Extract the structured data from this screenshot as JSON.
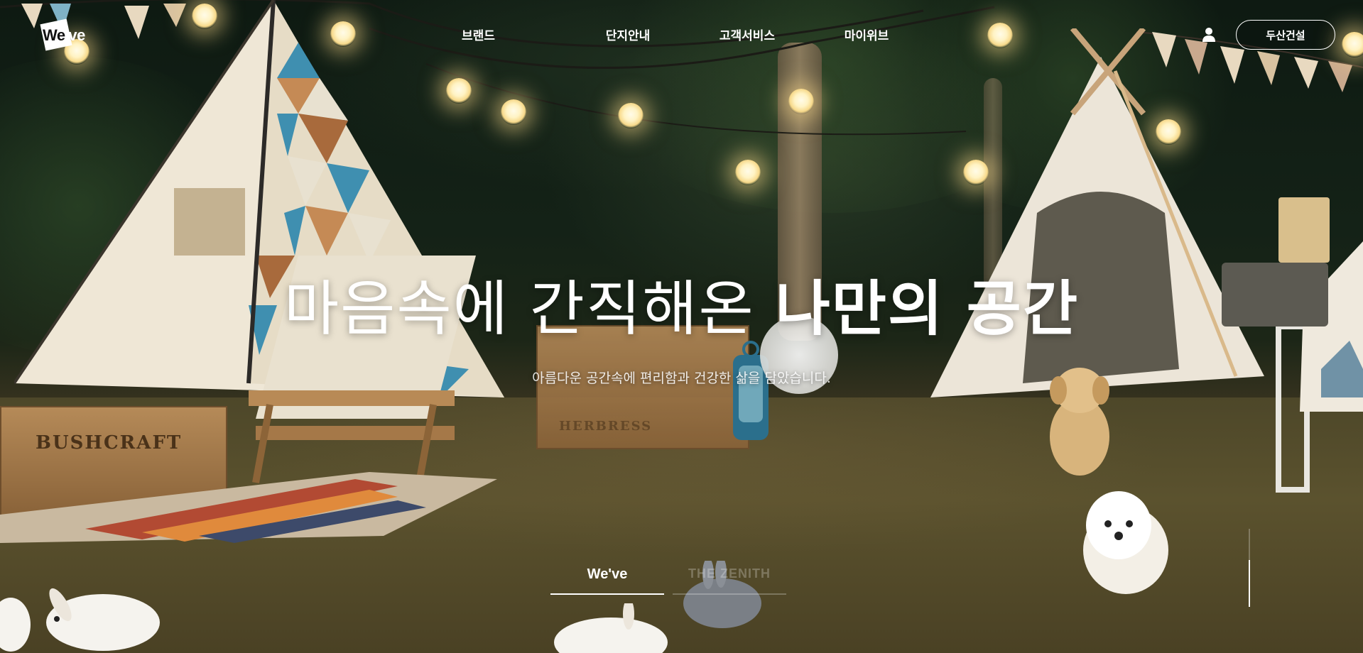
{
  "header": {
    "logo_text_dark": "We",
    "logo_text_light": "'ve",
    "nav": [
      {
        "label": "브랜드"
      },
      {
        "label": "단지안내"
      },
      {
        "label": "고객서비스"
      },
      {
        "label": "마이위브"
      }
    ],
    "user_icon": "user-icon",
    "company_button_label": "두산건설"
  },
  "hero": {
    "headline_light": "마음속에 간직해온 ",
    "headline_bold": "나만의 공간",
    "subtitle": "아름다운 공간속에 편리함과 건강한 삶을 담았습니다."
  },
  "tabs": [
    {
      "label": "We've",
      "active": true
    },
    {
      "label": "THE ZENITH",
      "active": false
    }
  ],
  "colors": {
    "text": "#ffffff",
    "accent": "#ffffff"
  }
}
